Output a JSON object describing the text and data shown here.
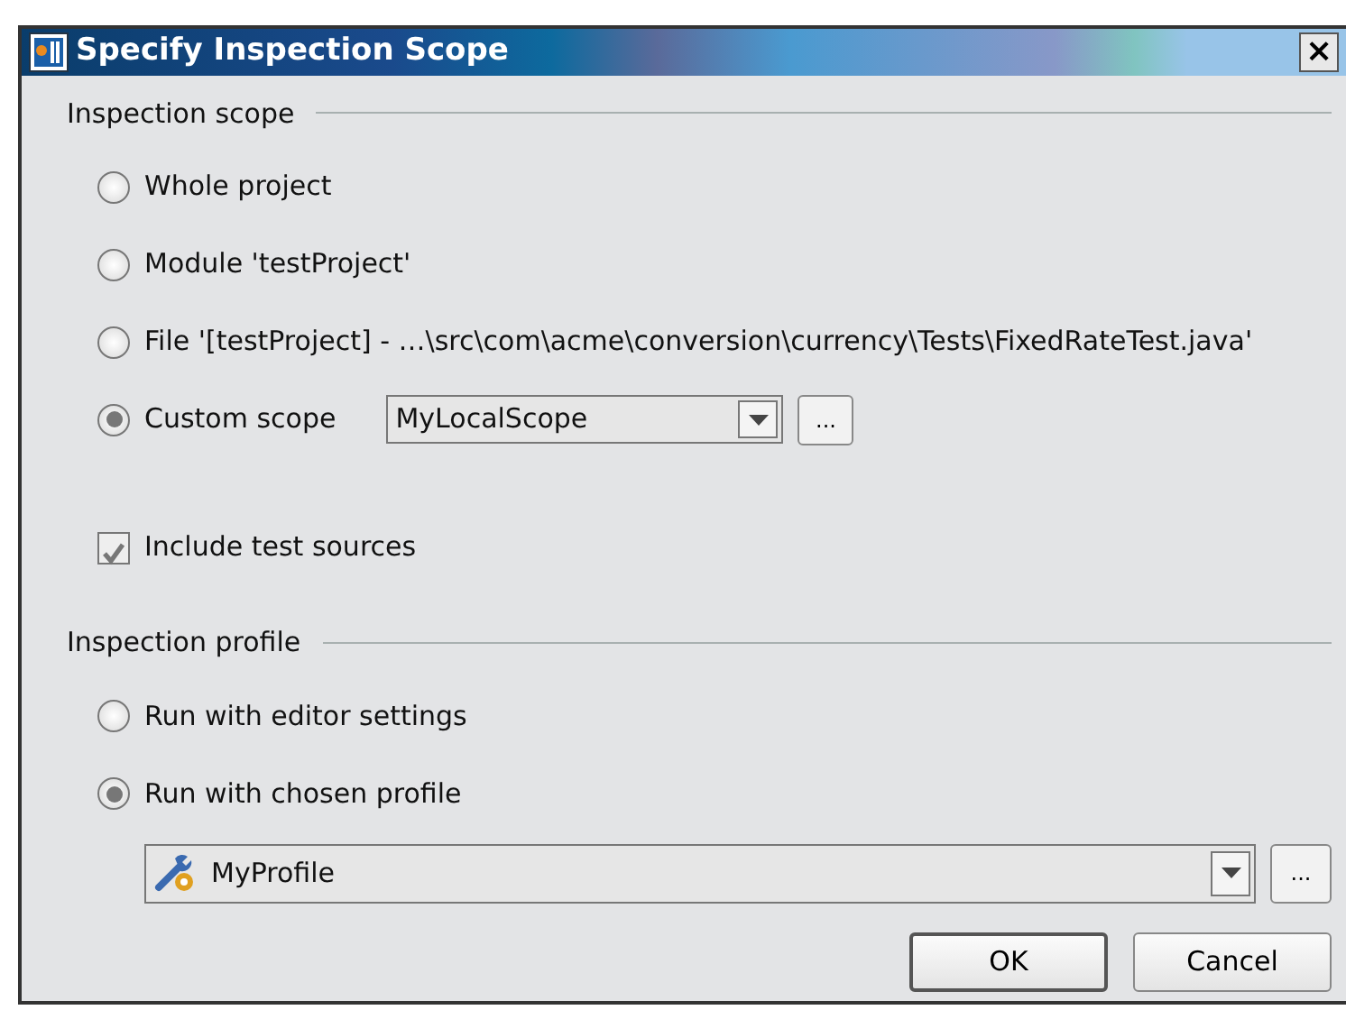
{
  "window": {
    "title": "Specify Inspection Scope",
    "close": "×"
  },
  "scope": {
    "heading": "Inspection scope",
    "options": [
      {
        "label": "Whole project",
        "selected": false
      },
      {
        "label": "Module 'testProject'",
        "selected": false
      },
      {
        "label": "File '[testProject] - …\\src\\com\\acme\\conversion\\currency\\Tests\\FixedRateTest.java'",
        "selected": false
      },
      {
        "label": "Custom scope",
        "selected": true,
        "combo": "MyLocalScope",
        "more": "..."
      }
    ],
    "include_tests": {
      "label": "Include test sources",
      "checked": true
    }
  },
  "profile": {
    "heading": "Inspection profile",
    "options": [
      {
        "label": "Run with editor settings",
        "selected": false
      },
      {
        "label": "Run with chosen profile",
        "selected": true
      }
    ],
    "combo": "MyProfile",
    "more": "..."
  },
  "buttons": [
    {
      "label": "OK",
      "default": true
    },
    {
      "label": "Cancel",
      "default": false
    }
  ]
}
